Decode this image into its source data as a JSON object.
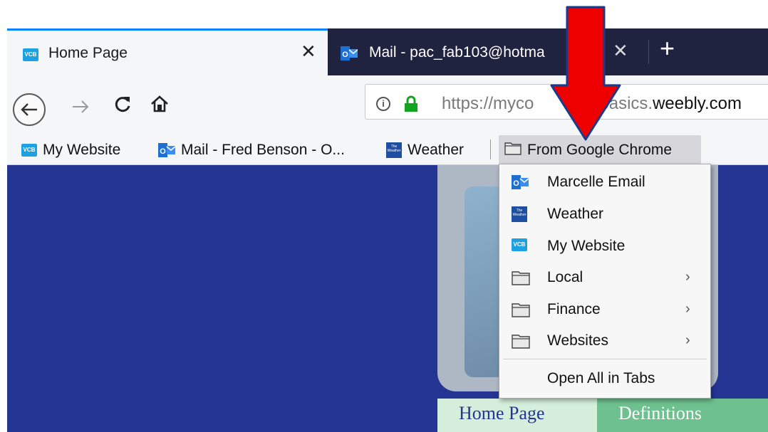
{
  "tabs": [
    {
      "title": "Home Page",
      "favicon": "vcb-icon",
      "active": true
    },
    {
      "title": "Mail - pac_fab103@hotma",
      "favicon": "outlook-icon",
      "active": false
    }
  ],
  "navbar": {
    "url_prefix": "https://myco",
    "url_mid": "basics.",
    "url_domain": "weebly.com"
  },
  "bookmarks": [
    {
      "label": "My Website",
      "icon": "vcb-icon"
    },
    {
      "label": "Mail - Fred Benson - O...",
      "icon": "outlook-icon"
    },
    {
      "label": "Weather",
      "icon": "weather-channel-icon"
    },
    {
      "label": "From Google Chrome",
      "icon": "folder-icon"
    }
  ],
  "menu": {
    "items": [
      {
        "label": "Marcelle Email",
        "icon": "outlook-icon",
        "submenu": false
      },
      {
        "label": "Weather",
        "icon": "weather-channel-icon",
        "submenu": false
      },
      {
        "label": "My Website",
        "icon": "vcb-icon",
        "submenu": false
      },
      {
        "label": "Local",
        "icon": "folder-icon",
        "submenu": true
      },
      {
        "label": "Finance",
        "icon": "folder-icon",
        "submenu": true
      },
      {
        "label": "Websites",
        "icon": "folder-icon",
        "submenu": true
      }
    ],
    "open_all_label": "Open All in Tabs"
  },
  "site_nav": {
    "home_label": "Home Page",
    "definitions_label": "Definitions"
  },
  "colors": {
    "page_bg": "#243594",
    "tabstrip": "#202340",
    "accent": "#0a84ff",
    "arrow": "#ee0000"
  }
}
